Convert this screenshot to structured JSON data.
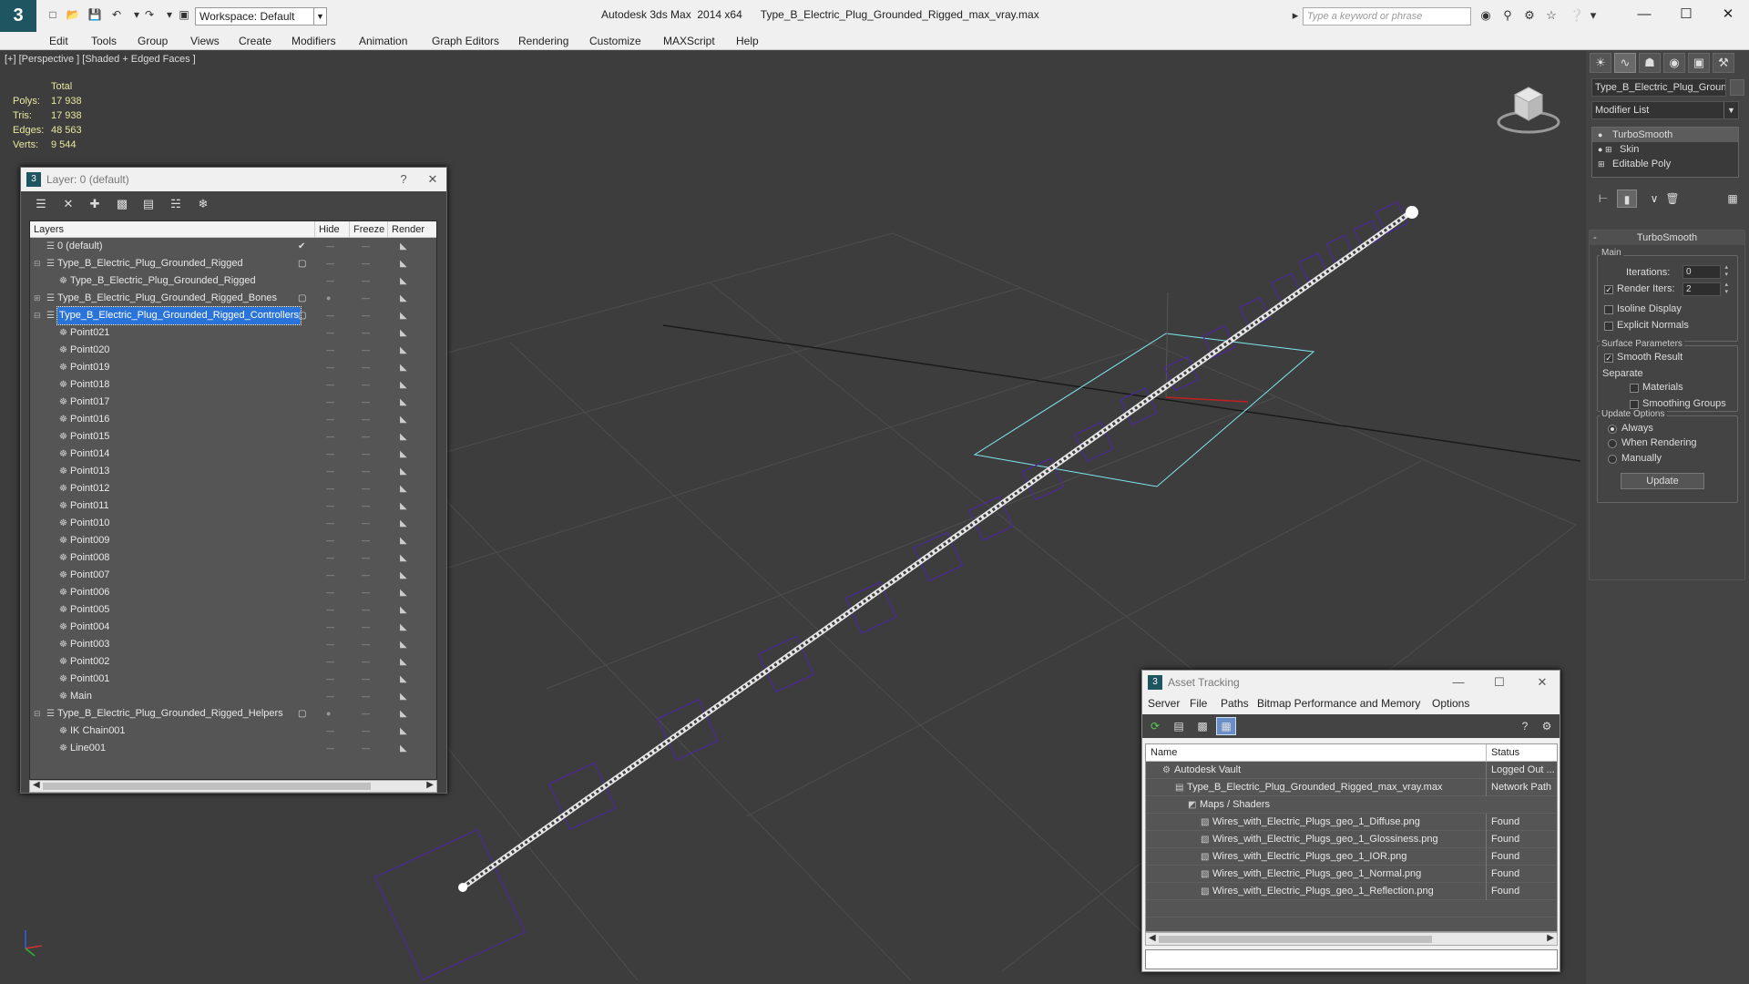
{
  "app": {
    "title": "Autodesk 3ds Max  2014 x64",
    "file": "Type_B_Electric_Plug_Grounded_Rigged_max_vray.max",
    "workspace": "Workspace: Default",
    "search_placeholder": "Type a keyword or phrase",
    "logo_letter": "3"
  },
  "menu": [
    "Edit",
    "Tools",
    "Group",
    "Views",
    "Create",
    "Modifiers",
    "Animation",
    "Graph Editors",
    "Rendering",
    "Customize",
    "MAXScript",
    "Help"
  ],
  "viewport": {
    "label": "[+] [Perspective ] [Shaded + Edged Faces ]",
    "stats": {
      "header": "Total",
      "rows": [
        {
          "label": "Polys:",
          "value": "17 938"
        },
        {
          "label": "Tris:",
          "value": "17 938"
        },
        {
          "label": "Edges:",
          "value": "48 563"
        },
        {
          "label": "Verts:",
          "value": "9 544"
        }
      ]
    }
  },
  "layer_dialog": {
    "title": "Layer: 0 (default)",
    "help": "?",
    "columns": [
      "Layers",
      "Hide",
      "Freeze",
      "Render"
    ],
    "rows": [
      {
        "name": "0 (default)",
        "level": 0,
        "expand": "",
        "active": "✔",
        "hide": "—",
        "icon": "layer"
      },
      {
        "name": "Type_B_Electric_Plug_Grounded_Rigged",
        "level": 0,
        "expand": "⊟",
        "active": "▢",
        "hide": "—",
        "icon": "layer"
      },
      {
        "name": "Type_B_Electric_Plug_Grounded_Rigged",
        "level": 1,
        "expand": "",
        "active": "",
        "hide": "—",
        "icon": "obj"
      },
      {
        "name": "Type_B_Electric_Plug_Grounded_Rigged_Bones",
        "level": 0,
        "expand": "⊞",
        "active": "▢",
        "hide": "●",
        "icon": "layer"
      },
      {
        "name": "Type_B_Electric_Plug_Grounded_Rigged_Controllers",
        "level": 0,
        "expand": "⊟",
        "active": "▢",
        "hide": "—",
        "icon": "layer",
        "selected": true
      },
      {
        "name": "Point021",
        "level": 1,
        "expand": "",
        "active": "",
        "hide": "—",
        "icon": "obj"
      },
      {
        "name": "Point020",
        "level": 1,
        "expand": "",
        "active": "",
        "hide": "—",
        "icon": "obj"
      },
      {
        "name": "Point019",
        "level": 1,
        "expand": "",
        "active": "",
        "hide": "—",
        "icon": "obj"
      },
      {
        "name": "Point018",
        "level": 1,
        "expand": "",
        "active": "",
        "hide": "—",
        "icon": "obj"
      },
      {
        "name": "Point017",
        "level": 1,
        "expand": "",
        "active": "",
        "hide": "—",
        "icon": "obj"
      },
      {
        "name": "Point016",
        "level": 1,
        "expand": "",
        "active": "",
        "hide": "—",
        "icon": "obj"
      },
      {
        "name": "Point015",
        "level": 1,
        "expand": "",
        "active": "",
        "hide": "—",
        "icon": "obj"
      },
      {
        "name": "Point014",
        "level": 1,
        "expand": "",
        "active": "",
        "hide": "—",
        "icon": "obj"
      },
      {
        "name": "Point013",
        "level": 1,
        "expand": "",
        "active": "",
        "hide": "—",
        "icon": "obj"
      },
      {
        "name": "Point012",
        "level": 1,
        "expand": "",
        "active": "",
        "hide": "—",
        "icon": "obj"
      },
      {
        "name": "Point011",
        "level": 1,
        "expand": "",
        "active": "",
        "hide": "—",
        "icon": "obj"
      },
      {
        "name": "Point010",
        "level": 1,
        "expand": "",
        "active": "",
        "hide": "—",
        "icon": "obj"
      },
      {
        "name": "Point009",
        "level": 1,
        "expand": "",
        "active": "",
        "hide": "—",
        "icon": "obj"
      },
      {
        "name": "Point008",
        "level": 1,
        "expand": "",
        "active": "",
        "hide": "—",
        "icon": "obj"
      },
      {
        "name": "Point007",
        "level": 1,
        "expand": "",
        "active": "",
        "hide": "—",
        "icon": "obj"
      },
      {
        "name": "Point006",
        "level": 1,
        "expand": "",
        "active": "",
        "hide": "—",
        "icon": "obj"
      },
      {
        "name": "Point005",
        "level": 1,
        "expand": "",
        "active": "",
        "hide": "—",
        "icon": "obj"
      },
      {
        "name": "Point004",
        "level": 1,
        "expand": "",
        "active": "",
        "hide": "—",
        "icon": "obj"
      },
      {
        "name": "Point003",
        "level": 1,
        "expand": "",
        "active": "",
        "hide": "—",
        "icon": "obj"
      },
      {
        "name": "Point002",
        "level": 1,
        "expand": "",
        "active": "",
        "hide": "—",
        "icon": "obj"
      },
      {
        "name": "Point001",
        "level": 1,
        "expand": "",
        "active": "",
        "hide": "—",
        "icon": "obj"
      },
      {
        "name": "Main",
        "level": 1,
        "expand": "",
        "active": "",
        "hide": "—",
        "icon": "obj"
      },
      {
        "name": "Type_B_Electric_Plug_Grounded_Rigged_Helpers",
        "level": 0,
        "expand": "⊟",
        "active": "▢",
        "hide": "●",
        "icon": "layer"
      },
      {
        "name": "IK Chain001",
        "level": 1,
        "expand": "",
        "active": "",
        "hide": "—",
        "icon": "obj"
      },
      {
        "name": "Line001",
        "level": 1,
        "expand": "",
        "active": "",
        "hide": "—",
        "icon": "obj"
      }
    ]
  },
  "command_panel": {
    "object_name": "Type_B_Electric_Plug_Grounded_Rigged",
    "modifier_list": "Modifier List",
    "stack": [
      {
        "name": "TurboSmooth",
        "expand": ""
      },
      {
        "name": "Skin",
        "expand": "⊞"
      },
      {
        "name": "Editable Poly",
        "expand": "⊞"
      }
    ],
    "turbosmooth": {
      "title": "TurboSmooth",
      "main_label": "Main",
      "iterations_label": "Iterations:",
      "iterations": "0",
      "render_iters_label": "Render Iters:",
      "render_iters": "2",
      "isoline": "Isoline Display",
      "explicit": "Explicit Normals",
      "surface_label": "Surface Parameters",
      "smooth_result": "Smooth Result",
      "separate_label": "Separate",
      "materials": "Materials",
      "smoothing_groups": "Smoothing Groups",
      "update_label": "Update Options",
      "always": "Always",
      "when_rendering": "When Rendering",
      "manually": "Manually",
      "update_button": "Update"
    }
  },
  "asset_dialog": {
    "title": "Asset Tracking",
    "menu": [
      "Server",
      "File",
      "Paths",
      "Bitmap Performance and Memory",
      "Options"
    ],
    "columns": [
      "Name",
      "Status"
    ],
    "rows": [
      {
        "name": "Autodesk Vault",
        "status": "Logged Out ...",
        "level": 0,
        "icon": "⚙"
      },
      {
        "name": "Type_B_Electric_Plug_Grounded_Rigged_max_vray.max",
        "status": "Network Path",
        "level": 1,
        "icon": "▤"
      },
      {
        "name": "Maps / Shaders",
        "status": "",
        "level": 2,
        "icon": "◩"
      },
      {
        "name": "Wires_with_Electric_Plugs_geo_1_Diffuse.png",
        "status": "Found",
        "level": 3,
        "icon": "▧"
      },
      {
        "name": "Wires_with_Electric_Plugs_geo_1_Glossiness.png",
        "status": "Found",
        "level": 3,
        "icon": "▧"
      },
      {
        "name": "Wires_with_Electric_Plugs_geo_1_IOR.png",
        "status": "Found",
        "level": 3,
        "icon": "▧"
      },
      {
        "name": "Wires_with_Electric_Plugs_geo_1_Normal.png",
        "status": "Found",
        "level": 3,
        "icon": "▧"
      },
      {
        "name": "Wires_with_Electric_Plugs_geo_1_Reflection.png",
        "status": "Found",
        "level": 3,
        "icon": "▧"
      },
      {
        "name": "",
        "status": "",
        "level": 0,
        "icon": ""
      }
    ]
  },
  "colors": {
    "selection": "#2a73d8",
    "helper": "#4a2a9a",
    "grid_highlight": "#7fe8f0"
  }
}
